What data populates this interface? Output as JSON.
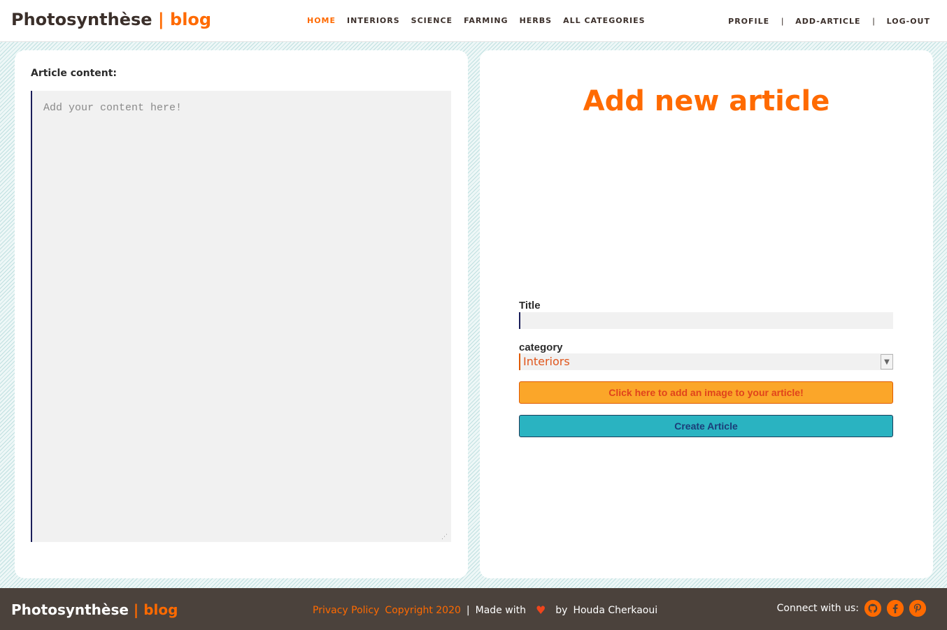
{
  "header": {
    "brand_name": "Photosynthèse",
    "brand_accent": "| blog",
    "nav": [
      {
        "label": "HOME",
        "active": true
      },
      {
        "label": "INTERIORS"
      },
      {
        "label": "SCIENCE"
      },
      {
        "label": "FARMING"
      },
      {
        "label": "HERBS"
      },
      {
        "label": "ALL CATEGORIES"
      }
    ],
    "user_nav": {
      "profile": "PROFILE",
      "add_article": "ADD-ARTICLE",
      "logout": "LOG-OUT",
      "separator": "|"
    }
  },
  "content_panel": {
    "label": "Article content:",
    "placeholder": "Add your content here!",
    "value": ""
  },
  "form": {
    "heading": "Add new article",
    "title_label": "Title",
    "title_value": "",
    "category_label": "category",
    "category_selected": "Interiors",
    "image_button": "Click here to add an image to your article!",
    "create_button": "Create Article"
  },
  "footer": {
    "brand_name": "Photosynthèse",
    "brand_accent": "| blog",
    "privacy": "Privacy Policy",
    "copyright": "Copyright 2020",
    "separator": "|",
    "made_with": "Made with",
    "by": "by",
    "author": "Houda Cherkaoui",
    "connect": "Connect with us:",
    "social_icons": [
      "github-icon",
      "facebook-icon",
      "pinterest-icon"
    ]
  },
  "colors": {
    "accent": "#ff6a00",
    "footer_bg": "#4b423c",
    "image_button_bg": "#fba629",
    "create_button_bg": "#2ab3c1"
  }
}
